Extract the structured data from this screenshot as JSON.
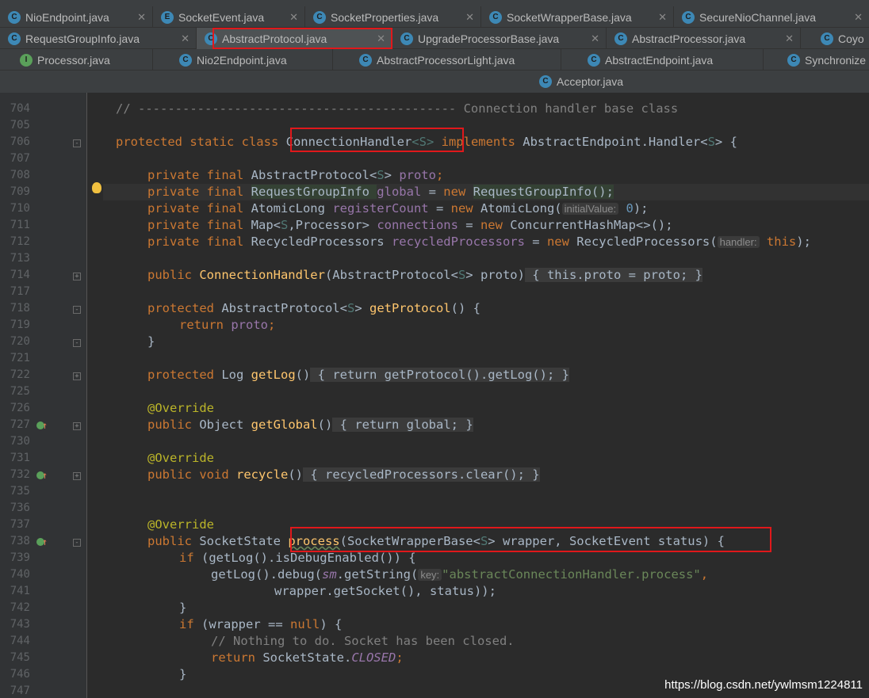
{
  "tabs": {
    "row1": [
      {
        "name": "NioEndpoint.java",
        "icon": "c"
      },
      {
        "name": "SocketEvent.java",
        "icon": "e"
      },
      {
        "name": "SocketProperties.java",
        "icon": "c"
      },
      {
        "name": "SocketWrapperBase.java",
        "icon": "c"
      },
      {
        "name": "SecureNioChannel.java",
        "icon": "c"
      }
    ],
    "row2": [
      {
        "name": "RequestGroupInfo.java",
        "icon": "c"
      },
      {
        "name": "AbstractProtocol.java",
        "icon": "c"
      },
      {
        "name": "UpgradeProcessorBase.java",
        "icon": "c"
      },
      {
        "name": "AbstractProcessor.java",
        "icon": "c"
      },
      {
        "name": "Coyo",
        "icon": "c"
      }
    ],
    "row3": [
      {
        "name": "Processor.java",
        "icon": "i"
      },
      {
        "name": "Nio2Endpoint.java",
        "icon": "c"
      },
      {
        "name": "AbstractProcessorLight.java",
        "icon": "c"
      },
      {
        "name": "AbstractEndpoint.java",
        "icon": "c"
      },
      {
        "name": "Synchronize",
        "icon": "c"
      }
    ],
    "row4": [
      {
        "name": "Acceptor.java",
        "icon": "c"
      }
    ],
    "close_glyph": "✕",
    "icon_letters": {
      "c": "C",
      "e": "E",
      "i": "I"
    }
  },
  "editor": {
    "line_numbers": [
      "704",
      "705",
      "706",
      "707",
      "708",
      "709",
      "710",
      "711",
      "712",
      "713",
      "714",
      "717",
      "718",
      "719",
      "720",
      "721",
      "722",
      "725",
      "726",
      "727",
      "730",
      "731",
      "732",
      "735",
      "736",
      "737",
      "738",
      "739",
      "740",
      "741",
      "742",
      "743",
      "744",
      "745",
      "746",
      "747"
    ],
    "lines": {
      "l704": "// ------------------------------------------- Connection handler base class",
      "l706": [
        "protected static class ",
        "ConnectionHandler",
        "<S>",
        " implements ",
        "AbstractEndpoint.Handler<",
        "S",
        "> {"
      ],
      "l708": [
        "private final ",
        "AbstractProtocol<",
        "S",
        "> ",
        "proto",
        ";"
      ],
      "l709": [
        "private final ",
        "RequestGroupInfo ",
        "global",
        " = ",
        "new ",
        "RequestGroupInfo();"
      ],
      "l710": [
        "private final ",
        "AtomicLong ",
        "registerCount",
        " = ",
        "new ",
        "AtomicLong(",
        "initialValue:",
        " ",
        "0",
        ");"
      ],
      "l711": [
        "private final ",
        "Map<",
        "S",
        ",Processor> ",
        "connections",
        " = ",
        "new ",
        "ConcurrentHashMap<>();"
      ],
      "l712": [
        "private final ",
        "RecycledProcessors ",
        "recycledProcessors",
        " = ",
        "new ",
        "RecycledProcessors(",
        "handler:",
        " ",
        "this",
        ");"
      ],
      "l714": [
        "public ",
        "ConnectionHandler",
        "(AbstractProtocol<",
        "S",
        "> proto)",
        " { ",
        "this",
        ".",
        "proto",
        " = proto; }"
      ],
      "l718": [
        "protected ",
        "AbstractProtocol<",
        "S",
        "> ",
        "getProtocol",
        "() {"
      ],
      "l719": [
        "return ",
        "proto",
        ";"
      ],
      "l720": "}",
      "l722": [
        "protected ",
        "Log ",
        "getLog",
        "()",
        " { ",
        "return ",
        "getProtocol().getLog(); }"
      ],
      "l726": "@Override",
      "l727": [
        "public ",
        "Object ",
        "getGlobal",
        "()",
        " { ",
        "return ",
        "global",
        "; }"
      ],
      "l731": "@Override",
      "l732": [
        "public void ",
        "recycle",
        "()",
        " { ",
        "recycledProcessors",
        ".clear(); }"
      ],
      "l737": "@Override",
      "l738": [
        "public ",
        "SocketState ",
        "process",
        "(SocketWrapperBase<",
        "S",
        "> wrapper, SocketEvent status) {"
      ],
      "l739": [
        "if ",
        "(getLog().isDebugEnabled()) {"
      ],
      "l740": [
        "getLog().debug(",
        "sm",
        ".getString(",
        "key:",
        "\"abstractConnectionHandler.process\"",
        ","
      ],
      "l741": "wrapper.getSocket(), status));",
      "l742": "}",
      "l743": [
        "if ",
        "(wrapper == ",
        "null",
        ") {"
      ],
      "l744": "// Nothing to do. Socket has been closed.",
      "l745": [
        "return ",
        "SocketState.",
        "CLOSED",
        ";"
      ],
      "l746": "}"
    }
  },
  "watermark": "https://blog.csdn.net/ywlmsm1224811"
}
